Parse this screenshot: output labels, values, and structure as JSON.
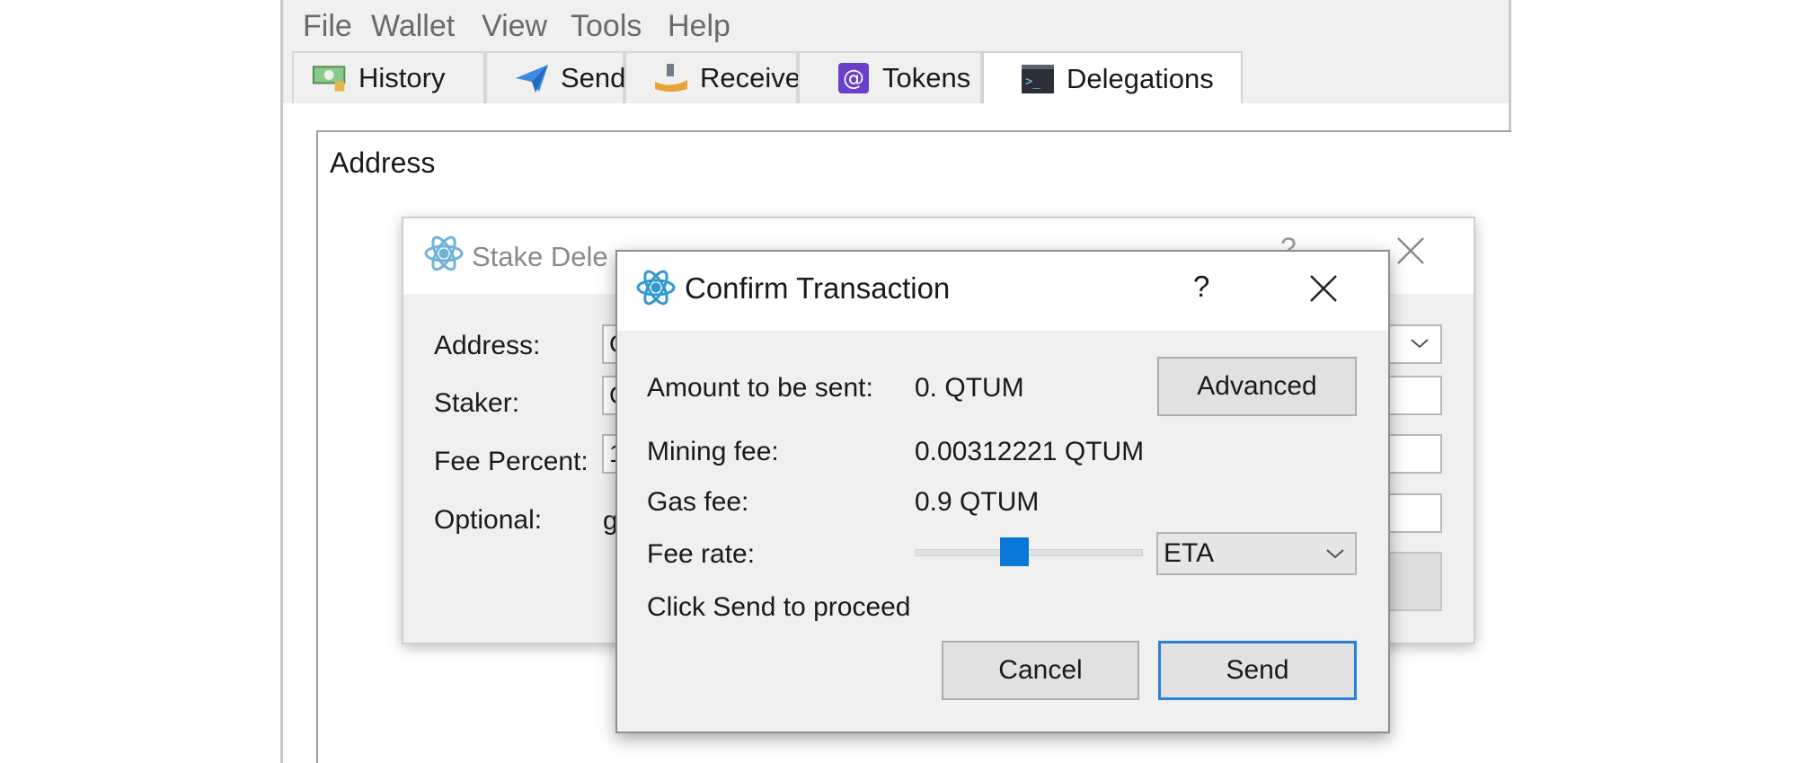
{
  "menu": [
    "File",
    "Wallet",
    "View",
    "Tools",
    "Help"
  ],
  "tabs": [
    {
      "label": "History",
      "icon": "history-money-icon"
    },
    {
      "label": "Send",
      "icon": "paper-plane-icon"
    },
    {
      "label": "Receive",
      "icon": "receive-hand-icon"
    },
    {
      "label": "Tokens",
      "icon": "at-sign-icon"
    },
    {
      "label": "Delegations",
      "icon": "terminal-icon",
      "active": true
    }
  ],
  "content": {
    "address_heading": "Address"
  },
  "stake_dialog": {
    "title": "Stake Dele",
    "help": "?",
    "labels": [
      "Address:",
      "Staker:",
      "Fee Percent:",
      "Optional:"
    ],
    "field_values": [
      "C",
      "C",
      "1"
    ],
    "optional_value": "g"
  },
  "confirm_dialog": {
    "title": "Confirm Transaction",
    "help": "?",
    "amount_label": "Amount to be sent:",
    "amount_value": "0. QTUM",
    "advanced_label": "Advanced",
    "mining_fee_label": "Mining fee:",
    "mining_fee_value": "0.00312221 QTUM",
    "gas_fee_label": "Gas fee:",
    "gas_fee_value": "0.9 QTUM",
    "fee_rate_label": "Fee rate:",
    "fee_rate_slider_level": 0.43,
    "fee_rate_option": "ETA",
    "message": "Click Send to proceed",
    "cancel_label": "Cancel",
    "send_label": "Send"
  },
  "colors": {
    "accent": "#0a78d7",
    "default_button_border": "#2b7fd6",
    "qtum_logo": "#2e9ad0"
  }
}
